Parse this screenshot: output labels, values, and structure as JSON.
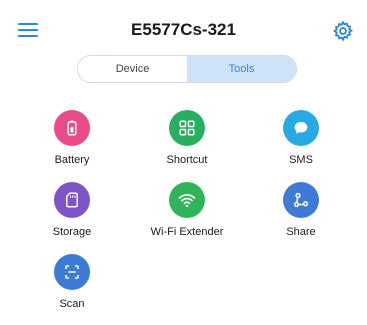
{
  "header": {
    "title": "E5577Cs-321"
  },
  "tabs": [
    {
      "label": "Device",
      "active": false
    },
    {
      "label": "Tools",
      "active": true
    }
  ],
  "tools": [
    {
      "label": "Battery",
      "icon": "battery-icon",
      "color": "#ea4c89"
    },
    {
      "label": "Shortcut",
      "icon": "shortcut-icon",
      "color": "#27ae60"
    },
    {
      "label": "SMS",
      "icon": "sms-icon",
      "color": "#29a9e1"
    },
    {
      "label": "Storage",
      "icon": "sd-card-icon",
      "color": "#7d55c7"
    },
    {
      "label": "Wi-Fi Extender",
      "icon": "wifi-icon",
      "color": "#2fb45a"
    },
    {
      "label": "Share",
      "icon": "share-icon",
      "color": "#3d7bd6"
    },
    {
      "label": "Scan",
      "icon": "scan-icon",
      "color": "#3d7bd6"
    }
  ],
  "colors": {
    "accent": "#2f86d4",
    "segment_active_bg": "#cfe3f6"
  }
}
